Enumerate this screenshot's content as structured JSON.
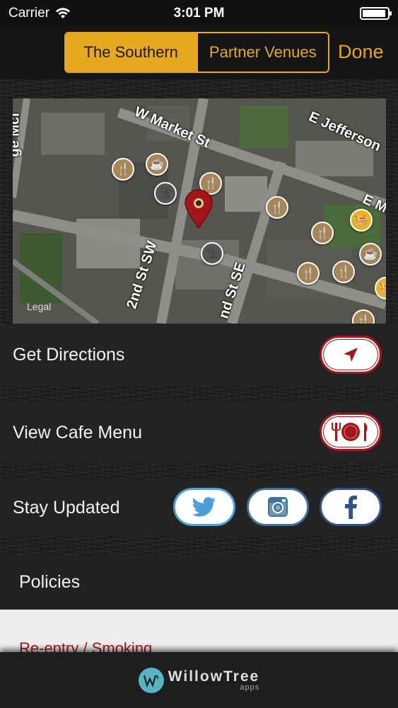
{
  "status_bar": {
    "carrier": "Carrier",
    "time": "3:01 PM",
    "battery_level": 0.95
  },
  "nav": {
    "segments": [
      "The Southern",
      "Partner Venues"
    ],
    "selected_segment": "The Southern",
    "done_label": "Done"
  },
  "map": {
    "street_labels": [
      "W Market St",
      "E Jefferson",
      "E Ma",
      "2nd St SW",
      "nd St SE",
      "ge Mcl"
    ],
    "legal_label": "Legal",
    "poi_icons": [
      "fork-knife-icon",
      "coffee-cup-icon",
      "camera-icon",
      "shopping-basket-icon"
    ],
    "pin_icon": "map-pin-icon"
  },
  "rows": {
    "directions_label": "Get Directions",
    "menu_label": "View Cafe Menu",
    "updates_label": "Stay Updated"
  },
  "policies": {
    "header": "Policies",
    "items": [
      "Re-entry / Smoking"
    ]
  },
  "footer": {
    "logo_name": "WillowTree",
    "logo_sub": "apps"
  },
  "colors": {
    "accent": "#e6a81e",
    "brand_red": "#a4161a",
    "twitter": "#4a9fd8",
    "facebook": "#31538a",
    "instagram": "#3f729b"
  }
}
